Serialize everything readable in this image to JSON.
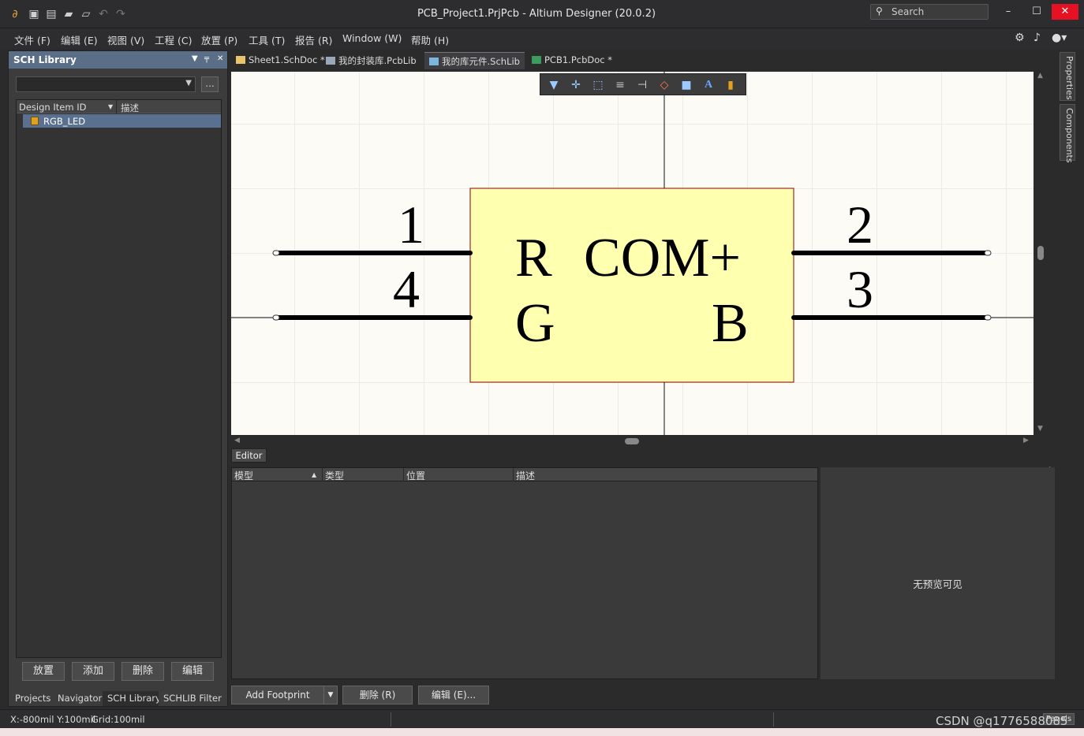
{
  "window": {
    "title": "PCB_Project1.PrjPcb - Altium Designer (20.0.2)",
    "search_placeholder": "Search",
    "minimize": "–",
    "maximize": "☐",
    "close": "✕"
  },
  "menu": [
    "文件 (F)",
    "编辑 (E)",
    "视图 (V)",
    "工程 (C)",
    "放置 (P)",
    "工具 (T)",
    "报告 (R)",
    "Window (W)",
    "帮助 (H)"
  ],
  "left_panel": {
    "title": "SCH Library",
    "columns": [
      "Design Item ID",
      "描述"
    ],
    "rows": [
      {
        "id": "RGB_LED",
        "desc": ""
      }
    ],
    "more_button": "...",
    "buttons": [
      "放置",
      "添加",
      "删除",
      "编辑"
    ],
    "tabs": [
      "Projects",
      "Navigator",
      "SCH Library",
      "SCHLIB Filter"
    ]
  },
  "doc_tabs": [
    {
      "label": "Sheet1.SchDoc *",
      "icon": "schdoc-icon",
      "active": false
    },
    {
      "label": "我的封装库.PcbLib",
      "icon": "pcblib-icon",
      "active": false
    },
    {
      "label": "我的库元件.SchLib",
      "icon": "schlib-icon",
      "active": true
    },
    {
      "label": "PCB1.PcbDoc *",
      "icon": "pcbdoc-icon",
      "active": false
    }
  ],
  "component": {
    "body_fill": "#ffffb0",
    "body_stroke": "#8b0000",
    "labels": {
      "r": "R",
      "com": "COM+",
      "g": "G",
      "b": "B"
    },
    "pins": {
      "p1": "1",
      "p2": "2",
      "p3": "3",
      "p4": "4"
    }
  },
  "editor": {
    "tab": "Editor",
    "model_columns": [
      "模型",
      "类型",
      "位置",
      "描述"
    ],
    "no_preview": "无预览可见",
    "buttons": [
      "Add Footprint",
      "删除 (R)",
      "编辑 (E)..."
    ]
  },
  "right_tabs": [
    "Properties",
    "Components"
  ],
  "status": {
    "coords": "X:-800mil Y:100mil",
    "grid": "Grid:100mil",
    "panels": "Panels"
  },
  "watermark": "CSDN @q1776588085"
}
